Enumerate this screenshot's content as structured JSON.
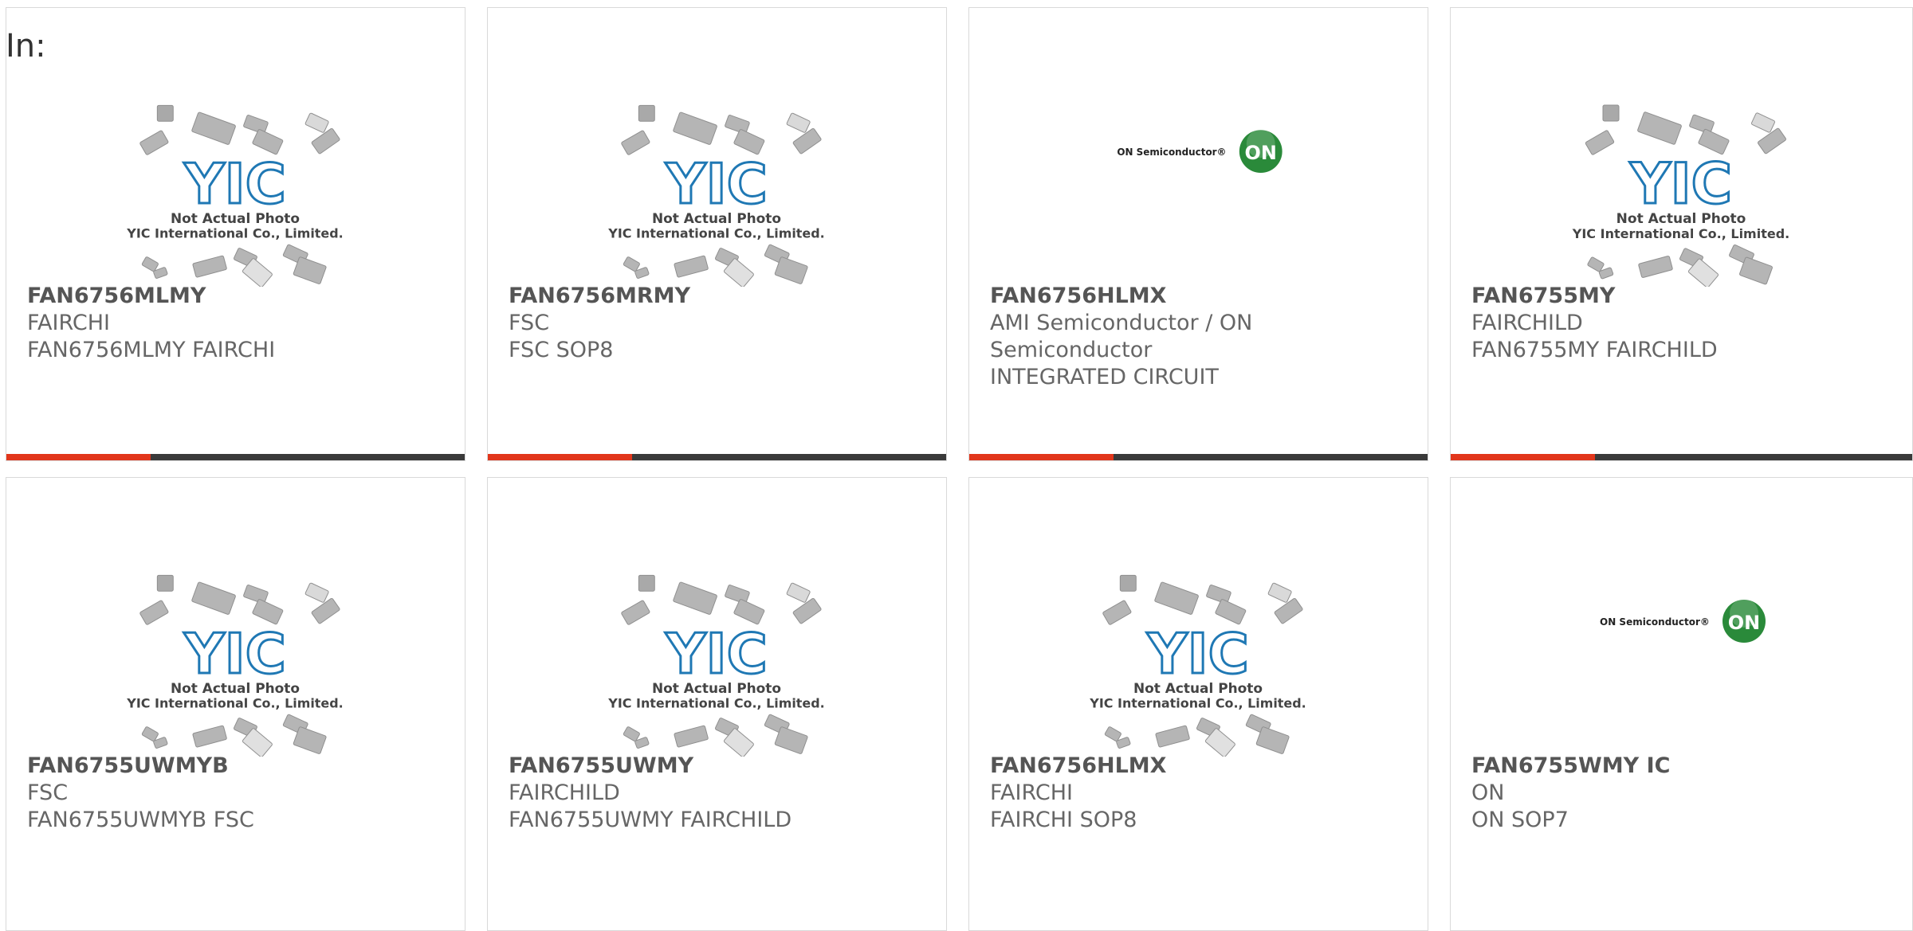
{
  "header": {
    "in_label": "In:"
  },
  "placeholder": {
    "logo": "YIC",
    "line1": "Not Actual Photo",
    "line2": "YIC International Co., Limited."
  },
  "on_logo": {
    "text": "ON Semiconductor®",
    "badge": "ON",
    "color": "#2a8a3a"
  },
  "colors": {
    "accent": "#e2361b",
    "bar": "#3a3a3a",
    "yic_blue": "#1f78b4"
  },
  "products": [
    {
      "part": "FAN6756MLMY",
      "mfr": "FAIRCHI",
      "desc": "FAN6756MLMY FAIRCHI",
      "image": "yic-placeholder"
    },
    {
      "part": "FAN6756MRMY",
      "mfr": "FSC",
      "desc": "FSC SOP8",
      "image": "yic-placeholder"
    },
    {
      "part": "FAN6756HLMX",
      "mfr": "AMI Semiconductor / ON Semiconductor",
      "desc": "INTEGRATED CIRCUIT",
      "image": "on-semi-logo"
    },
    {
      "part": "FAN6755MY",
      "mfr": "FAIRCHILD",
      "desc": "FAN6755MY FAIRCHILD",
      "image": "yic-placeholder"
    },
    {
      "part": "FAN6755UWMYB",
      "mfr": "FSC",
      "desc": "FAN6755UWMYB FSC",
      "image": "yic-placeholder"
    },
    {
      "part": "FAN6755UWMY",
      "mfr": "FAIRCHILD",
      "desc": "FAN6755UWMY FAIRCHILD",
      "image": "yic-placeholder"
    },
    {
      "part": "FAN6756HLMX",
      "mfr": "FAIRCHI",
      "desc": "FAIRCHI SOP8",
      "image": "yic-placeholder"
    },
    {
      "part": "FAN6755WMY IC",
      "mfr": "ON",
      "desc": "ON SOP7",
      "image": "on-semi-logo"
    }
  ]
}
